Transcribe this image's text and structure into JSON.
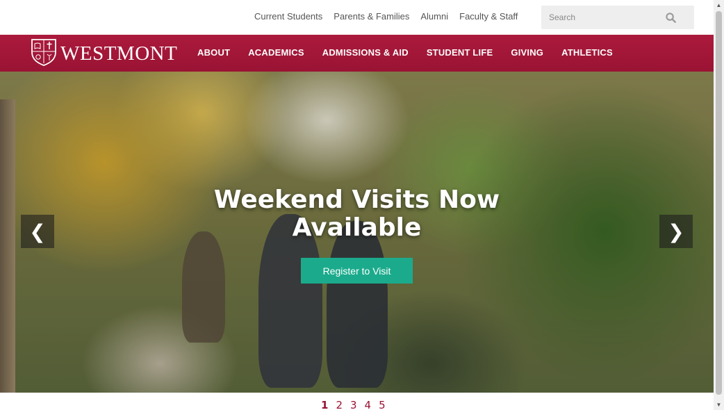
{
  "utility": {
    "links": [
      "Current Students",
      "Parents & Families",
      "Alumni",
      "Faculty & Staff"
    ],
    "search_placeholder": "Search"
  },
  "brand": {
    "name": "WESTMONT",
    "colors": {
      "primary": "#ab1a3c",
      "accent": "#1bab8c"
    }
  },
  "nav": {
    "items": [
      "ABOUT",
      "ACADEMICS",
      "ADMISSIONS & AID",
      "STUDENT LIFE",
      "GIVING",
      "ATHLETICS"
    ]
  },
  "hero": {
    "title": "Weekend Visits Now Available",
    "cta_label": "Register to Visit",
    "prev_icon": "❮",
    "next_icon": "❯"
  },
  "pager": {
    "pages": [
      "1",
      "2",
      "3",
      "4",
      "5"
    ],
    "active_index": 0
  },
  "icons": {
    "search": "search-icon",
    "logo": "shield-crest-icon",
    "scroll_up": "▲",
    "scroll_down": "▼"
  }
}
